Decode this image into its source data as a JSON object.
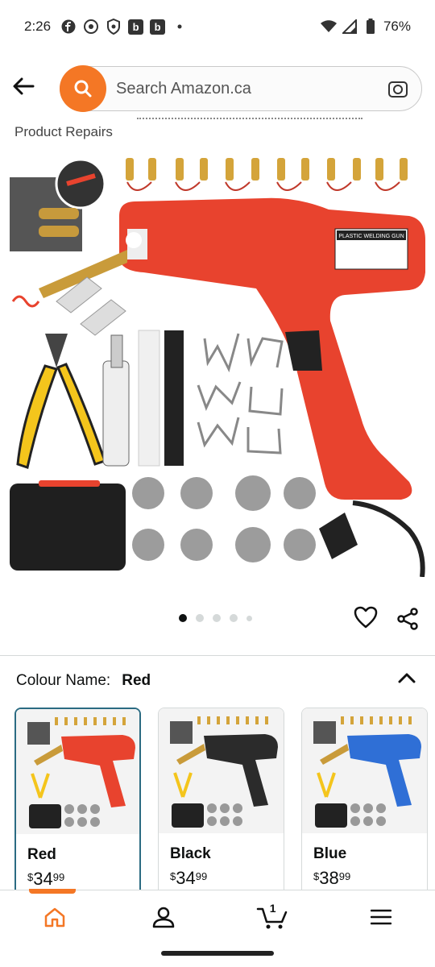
{
  "status_bar": {
    "time": "2:26",
    "battery": "76%",
    "icons": [
      "facebook-icon",
      "pinterest-icon",
      "shield-icon",
      "b-app-icon",
      "b-app-icon",
      "dot-icon",
      "wifi-icon",
      "signal-icon",
      "battery-icon"
    ],
    "b_label": "b"
  },
  "header": {
    "search_placeholder": "Search Amazon.ca"
  },
  "product": {
    "partial_title": "Product Repairs",
    "image_label": "PLASTIC WELDING GUN",
    "carousel_count": 5,
    "carousel_active": 1
  },
  "variation": {
    "label": "Colour Name:",
    "selected": "Red",
    "swatches": [
      {
        "name": "Red",
        "currency": "$",
        "whole": "34",
        "cents": "99",
        "color": "#e8432e"
      },
      {
        "name": "Black",
        "currency": "$",
        "whole": "34",
        "cents": "99",
        "color": "#2b2b2b"
      },
      {
        "name": "Blue",
        "currency": "$",
        "whole": "38",
        "cents": "99",
        "color": "#2f6fd6"
      }
    ]
  },
  "bottom_nav": {
    "items": [
      "home-icon",
      "account-icon",
      "cart-icon",
      "menu-icon"
    ],
    "cart_count": "1",
    "accent": "#f47725"
  }
}
